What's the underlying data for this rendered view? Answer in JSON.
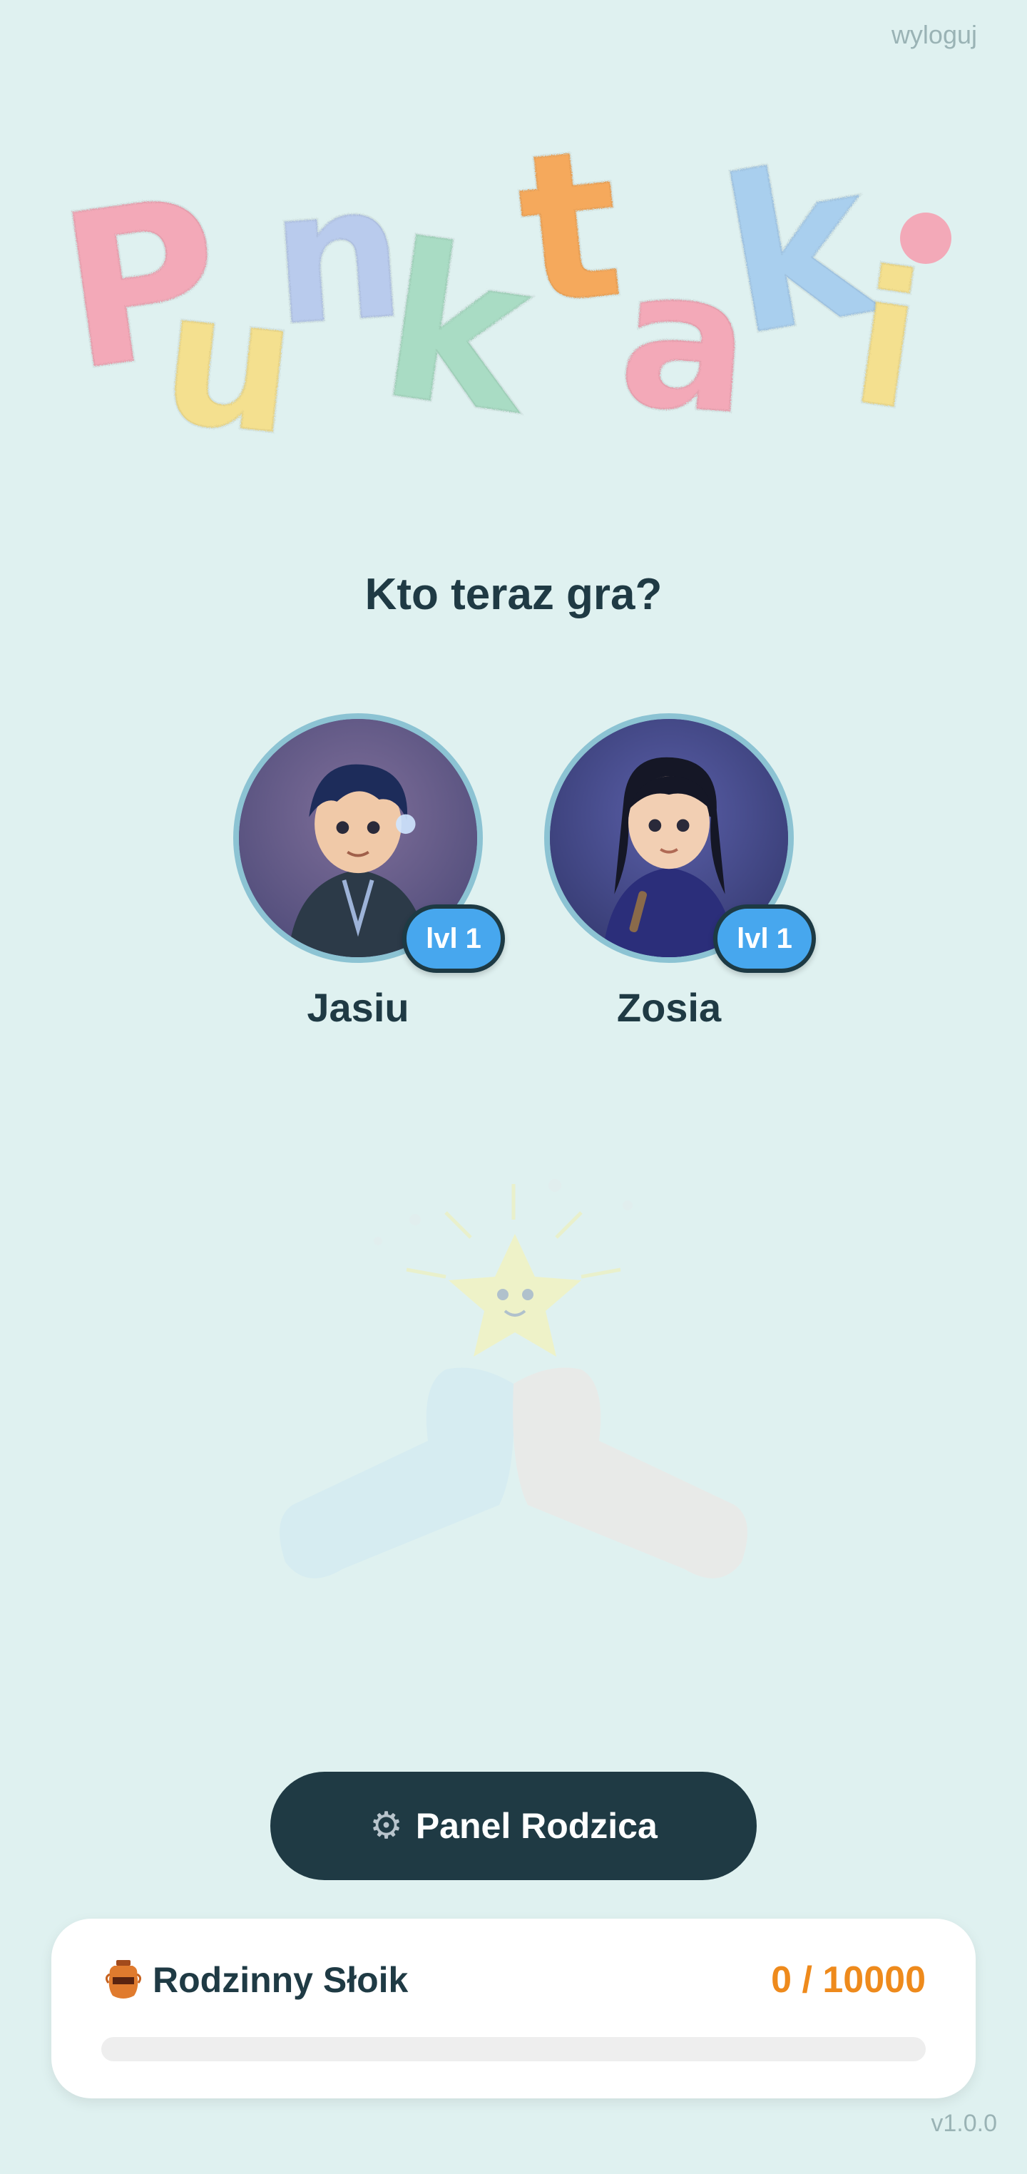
{
  "header": {
    "logout_label": "wyloguj"
  },
  "logo": {
    "letters": [
      {
        "ch": "P",
        "color": "#f3a9b8"
      },
      {
        "ch": "u",
        "color": "#f4e08f"
      },
      {
        "ch": "n",
        "color": "#b9cbed"
      },
      {
        "ch": "k",
        "color": "#a9dcc4"
      },
      {
        "ch": "t",
        "color": "#f5a95c"
      },
      {
        "ch": "a",
        "color": "#f3a9b8"
      },
      {
        "ch": "k",
        "color": "#a9cfee"
      },
      {
        "ch": "i",
        "color": "#f4e08f"
      }
    ]
  },
  "question": "Kto teraz gra?",
  "profiles": [
    {
      "name": "Jasiu",
      "level_label": "lvl 1"
    },
    {
      "name": "Zosia",
      "level_label": "lvl 1"
    }
  ],
  "panel_button": {
    "icon": "gear-icon",
    "label": "Panel Rodzica"
  },
  "jar": {
    "icon": "jar-icon",
    "title": "Rodzinny Słoik",
    "count_label": "0 / 10000",
    "progress": 0
  },
  "footer": {
    "version": "v1.0.0"
  },
  "colors": {
    "background": "#dff1f0",
    "dark": "#1f3a44",
    "accent_orange": "#ee8a1c",
    "badge_blue": "#47a7ee"
  }
}
